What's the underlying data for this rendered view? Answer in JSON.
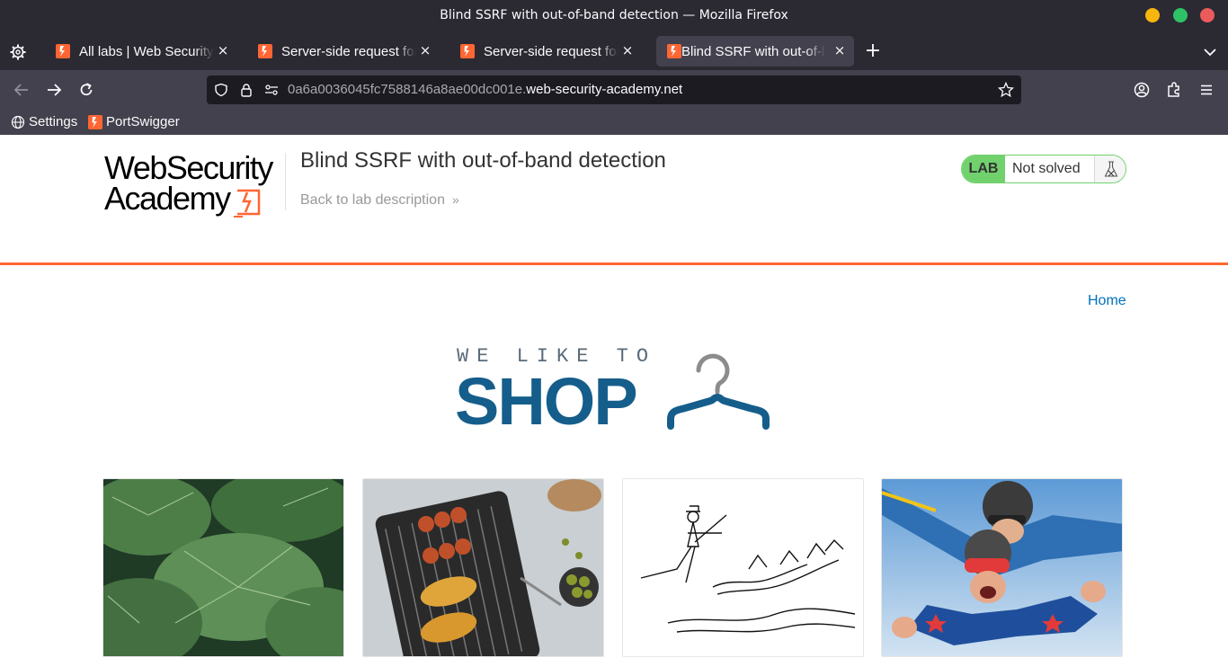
{
  "window": {
    "title": "Blind SSRF with out-of-band detection — Mozilla Firefox"
  },
  "tabs": [
    {
      "label": "All labs | Web Security Academy",
      "active": false
    },
    {
      "label": "Server-side request forgery",
      "active": false
    },
    {
      "label": "Server-side request forgery",
      "active": false
    },
    {
      "label": "Blind SSRF with out-of-band detection",
      "active": true
    }
  ],
  "tab_close_glyph": "×",
  "new_tab_glyph": "+",
  "urlbar": {
    "subdomain": "0a6a0036045fc7588146a8ae00dc001e.",
    "host": "web-security-academy.net"
  },
  "bookmarks": [
    {
      "label": "Settings",
      "icon": "globe-icon"
    },
    {
      "label": "PortSwigger",
      "icon": "portswigger-icon"
    }
  ],
  "lab": {
    "logo_line1": "WebSecurity",
    "logo_line2": "Academy",
    "title": "Blind SSRF with out-of-band detection",
    "back_link": "Back to lab description",
    "back_chevron": "»",
    "status_tag": "LAB",
    "status": "Not solved"
  },
  "shop": {
    "home_link": "Home",
    "logo_tagline": "WE LIKE TO",
    "logo_word": "SHOP"
  },
  "products": [
    {
      "image": "green-leaves"
    },
    {
      "image": "grilled-skewers"
    },
    {
      "image": "skater-sketch"
    },
    {
      "image": "skydivers"
    }
  ],
  "colors": {
    "accent_orange": "#ff6633",
    "lab_green": "#70d16d",
    "link_blue": "#0071bc",
    "shop_blue": "#155e8b",
    "chrome_dark": "#2b2a33",
    "chrome_mid": "#42414d"
  }
}
